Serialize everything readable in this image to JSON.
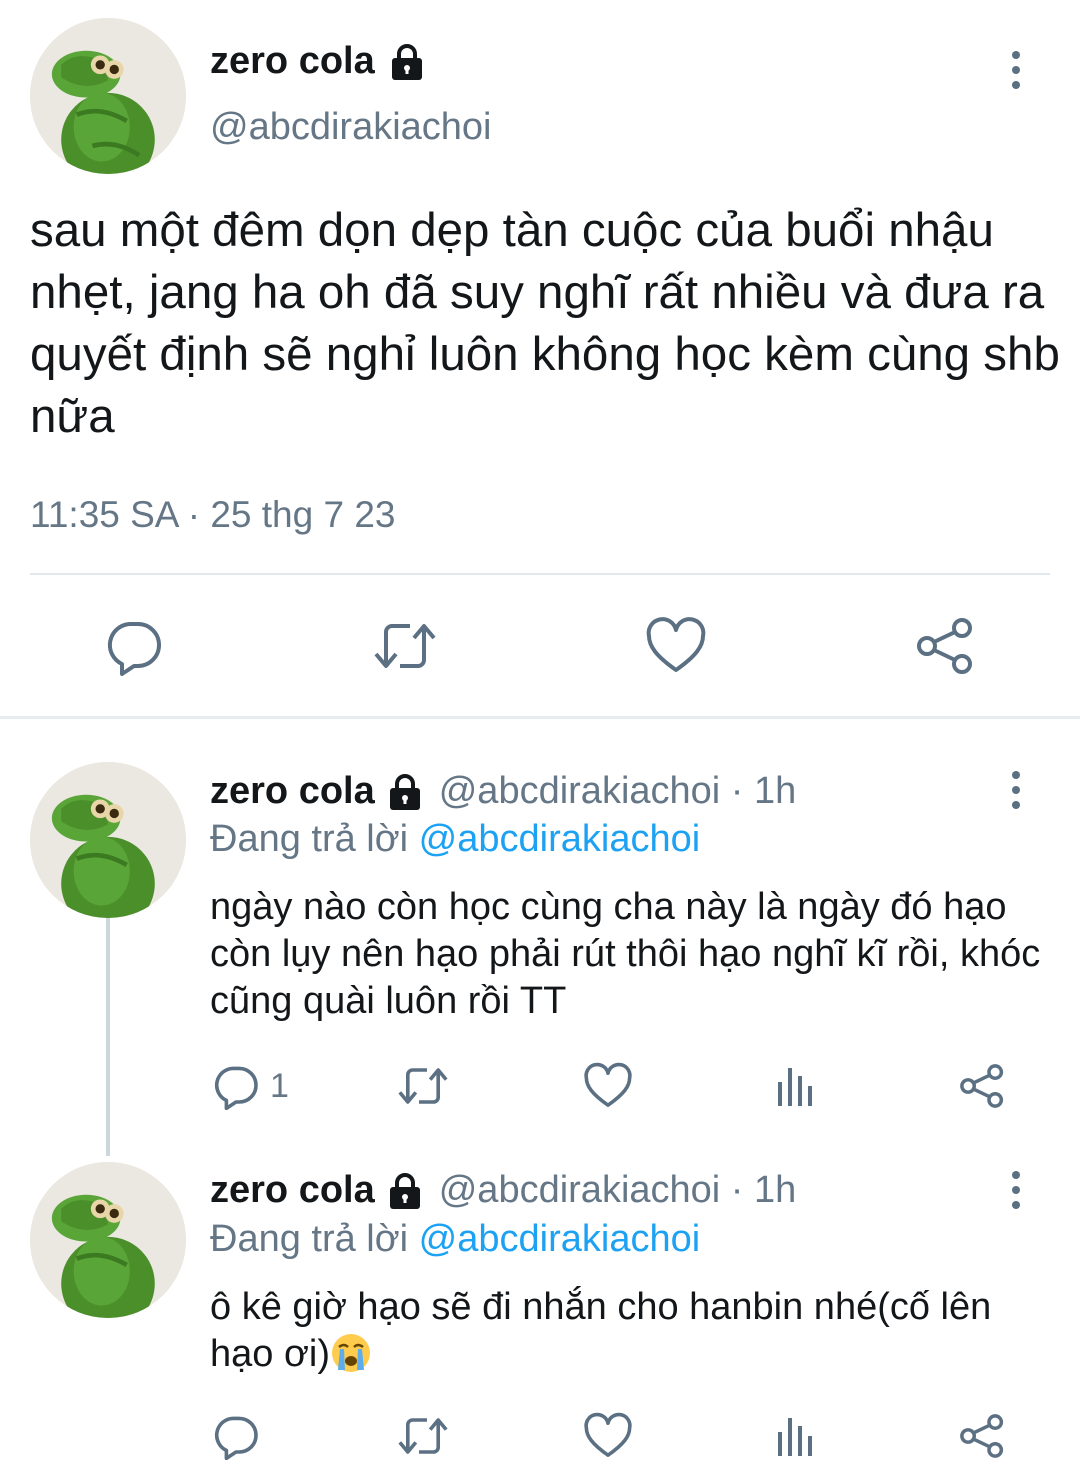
{
  "main_tweet": {
    "author_name": "zero cola",
    "handle": "@abcdirakiachoi",
    "text": "sau một đêm dọn dẹp tàn cuộc của buổi nhậu nhẹt, jang ha oh đã suy nghĩ rất nhiều và đưa ra quyết định sẽ nghỉ luôn không học kèm cùng shb nữa",
    "timestamp": "11:35 SA · 25 thg 7 23",
    "icons": [
      "reply-icon",
      "retweet-icon",
      "like-icon",
      "share-icon"
    ]
  },
  "replies": [
    {
      "author_name": "zero cola",
      "handle_time": "@abcdirakiachoi · 1h",
      "replying_prefix": "Đang trả lời",
      "replying_to": "@abcdirakiachoi",
      "text": "ngày nào còn học cùng cha này là ngày đó hạo còn lụy nên hạo phải rút thôi hạo nghĩ kĩ rồi, khóc cũng quài luôn rồi TT",
      "reply_count": "1"
    },
    {
      "author_name": "zero cola",
      "handle_time": "@abcdirakiachoi · 1h",
      "replying_prefix": "Đang trả lời",
      "replying_to": "@abcdirakiachoi",
      "text": "ô kê giờ hạo sẽ đi nhắn cho hanbin nhé(cố lên hạo ơi)",
      "emoji": "loudly-crying-face",
      "reply_count": ""
    }
  ],
  "colors": {
    "text": "#14171a",
    "secondary": "#657786",
    "link": "#1da1f2",
    "divider": "#e1e8ed",
    "icon": "#5b7083",
    "avatar_green": "#4f9a2e"
  }
}
